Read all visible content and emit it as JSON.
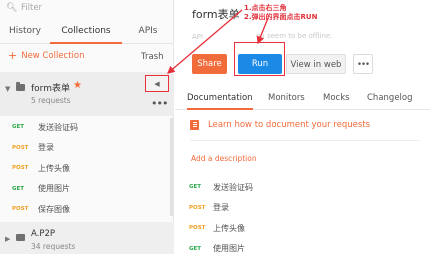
{
  "sidebar": {
    "search_placeholder": "Filter",
    "tabs": {
      "history": "History",
      "collections": "Collections",
      "apis": "APIs"
    },
    "new_collection": "New Collection",
    "trash": "Trash",
    "collection": {
      "name": "form表单",
      "count": "5 requests"
    },
    "requests": [
      {
        "method": "GET",
        "name": "发送验证码"
      },
      {
        "method": "POST",
        "name": "登录"
      },
      {
        "method": "POST",
        "name": "上传头像"
      },
      {
        "method": "GET",
        "name": "使用图片"
      },
      {
        "method": "POST",
        "name": "保存图像"
      }
    ],
    "collection2": {
      "name": "A.P2P",
      "count": "34 requests"
    }
  },
  "main": {
    "title": "form表单",
    "dim_left": "API",
    "dim_right": "ou seem to be offline.",
    "annotation_line1": "1.点击右三角",
    "annotation_line2": "2.弹出的界面点击RUN",
    "buttons": {
      "share": "Share",
      "run": "Run",
      "view_web": "View in web",
      "more": "•••"
    },
    "tabs": {
      "documentation": "Documentation",
      "monitors": "Monitors",
      "mocks": "Mocks",
      "changelog": "Changelog"
    },
    "learn_link": "Learn how to document your requests",
    "add_description": "Add a description",
    "requests": [
      {
        "method": "GET",
        "name": "发送验证码"
      },
      {
        "method": "POST",
        "name": "登录"
      },
      {
        "method": "POST",
        "name": "上传头像"
      },
      {
        "method": "GET",
        "name": "使用图片"
      }
    ]
  },
  "colors": {
    "accent": "#f26b3a",
    "run_blue": "#1b89e6",
    "annotation_red": "#e8303a",
    "get_green": "#2aa84a",
    "post_orange": "#f0a020"
  }
}
